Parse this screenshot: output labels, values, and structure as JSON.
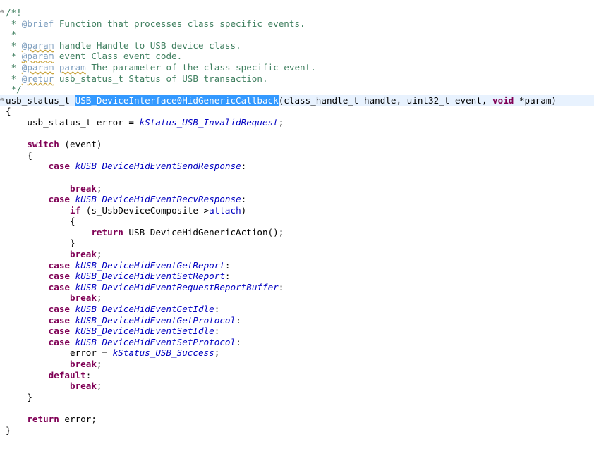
{
  "editor": {
    "lines": [
      {
        "fold": "⊖",
        "tokens": [
          {
            "t": "/*!",
            "c": "comment"
          }
        ]
      },
      {
        "fold": "",
        "tokens": [
          {
            "t": " * ",
            "c": "comment"
          },
          {
            "t": "@brief",
            "c": "doctag"
          },
          {
            "t": " Function that processes class specific events.",
            "c": "comment"
          }
        ]
      },
      {
        "fold": "",
        "tokens": [
          {
            "t": " *",
            "c": "comment"
          }
        ]
      },
      {
        "fold": "",
        "tokens": [
          {
            "t": " * ",
            "c": "comment"
          },
          {
            "t": "@param",
            "c": "doctag-misspelled"
          },
          {
            "t": " handle Handle to USB device class.",
            "c": "comment"
          }
        ]
      },
      {
        "fold": "",
        "tokens": [
          {
            "t": " * ",
            "c": "comment"
          },
          {
            "t": "@param",
            "c": "doctag-misspelled"
          },
          {
            "t": " event Class event code.",
            "c": "comment"
          }
        ]
      },
      {
        "fold": "",
        "tokens": [
          {
            "t": " * ",
            "c": "comment"
          },
          {
            "t": "@param",
            "c": "doctag-misspelled"
          },
          {
            "t": " ",
            "c": "comment"
          },
          {
            "t": "param",
            "c": "doctag-misspelled"
          },
          {
            "t": " The parameter of the class specific event.",
            "c": "comment"
          }
        ]
      },
      {
        "fold": "",
        "tokens": [
          {
            "t": " * ",
            "c": "comment"
          },
          {
            "t": "@retur",
            "c": "doctag-misspelled"
          },
          {
            "t": " usb_status_t Status of USB transaction.",
            "c": "comment"
          }
        ]
      },
      {
        "fold": "",
        "tokens": [
          {
            "t": " */",
            "c": "comment"
          }
        ]
      },
      {
        "fold": "⊖",
        "current": true,
        "tokens": [
          {
            "t": "usb_status_t ",
            "c": "plain"
          },
          {
            "t": "USB_DeviceInterface0HidGenericCallback",
            "c": "selected"
          },
          {
            "t": "(class_handle_t handle, uint32_t event, ",
            "c": "plain"
          },
          {
            "t": "void",
            "c": "keyword"
          },
          {
            "t": " *param)",
            "c": "plain"
          }
        ]
      },
      {
        "fold": "",
        "tokens": [
          {
            "t": "{",
            "c": "plain"
          }
        ]
      },
      {
        "fold": "",
        "tokens": [
          {
            "t": "    usb_status_t error = ",
            "c": "plain"
          },
          {
            "t": "kStatus_USB_InvalidRequest",
            "c": "enumconst"
          },
          {
            "t": ";",
            "c": "plain"
          }
        ]
      },
      {
        "fold": "",
        "tokens": [
          {
            "t": "",
            "c": "plain"
          }
        ]
      },
      {
        "fold": "",
        "tokens": [
          {
            "t": "    ",
            "c": "plain"
          },
          {
            "t": "switch",
            "c": "keyword"
          },
          {
            "t": " (event)",
            "c": "plain"
          }
        ]
      },
      {
        "fold": "",
        "tokens": [
          {
            "t": "    {",
            "c": "plain"
          }
        ]
      },
      {
        "fold": "",
        "tokens": [
          {
            "t": "        ",
            "c": "plain"
          },
          {
            "t": "case",
            "c": "keyword"
          },
          {
            "t": " ",
            "c": "plain"
          },
          {
            "t": "kUSB_DeviceHidEventSendResponse",
            "c": "enumconst"
          },
          {
            "t": ":",
            "c": "plain"
          }
        ]
      },
      {
        "fold": "",
        "tokens": [
          {
            "t": "",
            "c": "plain"
          }
        ]
      },
      {
        "fold": "",
        "tokens": [
          {
            "t": "            ",
            "c": "plain"
          },
          {
            "t": "break",
            "c": "keyword"
          },
          {
            "t": ";",
            "c": "plain"
          }
        ]
      },
      {
        "fold": "",
        "tokens": [
          {
            "t": "        ",
            "c": "plain"
          },
          {
            "t": "case",
            "c": "keyword"
          },
          {
            "t": " ",
            "c": "plain"
          },
          {
            "t": "kUSB_DeviceHidEventRecvResponse",
            "c": "enumconst"
          },
          {
            "t": ":",
            "c": "plain"
          }
        ]
      },
      {
        "fold": "",
        "tokens": [
          {
            "t": "            ",
            "c": "plain"
          },
          {
            "t": "if",
            "c": "keyword"
          },
          {
            "t": " (s_UsbDeviceComposite->",
            "c": "plain"
          },
          {
            "t": "attach",
            "c": "field"
          },
          {
            "t": ")",
            "c": "plain"
          }
        ]
      },
      {
        "fold": "",
        "tokens": [
          {
            "t": "            {",
            "c": "plain"
          }
        ]
      },
      {
        "fold": "",
        "tokens": [
          {
            "t": "                ",
            "c": "plain"
          },
          {
            "t": "return",
            "c": "keyword"
          },
          {
            "t": " USB_DeviceHidGenericAction();",
            "c": "plain"
          }
        ]
      },
      {
        "fold": "",
        "tokens": [
          {
            "t": "            }",
            "c": "plain"
          }
        ]
      },
      {
        "fold": "",
        "tokens": [
          {
            "t": "            ",
            "c": "plain"
          },
          {
            "t": "break",
            "c": "keyword"
          },
          {
            "t": ";",
            "c": "plain"
          }
        ]
      },
      {
        "fold": "",
        "tokens": [
          {
            "t": "        ",
            "c": "plain"
          },
          {
            "t": "case",
            "c": "keyword"
          },
          {
            "t": " ",
            "c": "plain"
          },
          {
            "t": "kUSB_DeviceHidEventGetReport",
            "c": "enumconst"
          },
          {
            "t": ":",
            "c": "plain"
          }
        ]
      },
      {
        "fold": "",
        "tokens": [
          {
            "t": "        ",
            "c": "plain"
          },
          {
            "t": "case",
            "c": "keyword"
          },
          {
            "t": " ",
            "c": "plain"
          },
          {
            "t": "kUSB_DeviceHidEventSetReport",
            "c": "enumconst"
          },
          {
            "t": ":",
            "c": "plain"
          }
        ]
      },
      {
        "fold": "",
        "tokens": [
          {
            "t": "        ",
            "c": "plain"
          },
          {
            "t": "case",
            "c": "keyword"
          },
          {
            "t": " ",
            "c": "plain"
          },
          {
            "t": "kUSB_DeviceHidEventRequestReportBuffer",
            "c": "enumconst"
          },
          {
            "t": ":",
            "c": "plain"
          }
        ]
      },
      {
        "fold": "",
        "tokens": [
          {
            "t": "            ",
            "c": "plain"
          },
          {
            "t": "break",
            "c": "keyword"
          },
          {
            "t": ";",
            "c": "plain"
          }
        ]
      },
      {
        "fold": "",
        "tokens": [
          {
            "t": "        ",
            "c": "plain"
          },
          {
            "t": "case",
            "c": "keyword"
          },
          {
            "t": " ",
            "c": "plain"
          },
          {
            "t": "kUSB_DeviceHidEventGetIdle",
            "c": "enumconst"
          },
          {
            "t": ":",
            "c": "plain"
          }
        ]
      },
      {
        "fold": "",
        "tokens": [
          {
            "t": "        ",
            "c": "plain"
          },
          {
            "t": "case",
            "c": "keyword"
          },
          {
            "t": " ",
            "c": "plain"
          },
          {
            "t": "kUSB_DeviceHidEventGetProtocol",
            "c": "enumconst"
          },
          {
            "t": ":",
            "c": "plain"
          }
        ]
      },
      {
        "fold": "",
        "tokens": [
          {
            "t": "        ",
            "c": "plain"
          },
          {
            "t": "case",
            "c": "keyword"
          },
          {
            "t": " ",
            "c": "plain"
          },
          {
            "t": "kUSB_DeviceHidEventSetIdle",
            "c": "enumconst"
          },
          {
            "t": ":",
            "c": "plain"
          }
        ]
      },
      {
        "fold": "",
        "tokens": [
          {
            "t": "        ",
            "c": "plain"
          },
          {
            "t": "case",
            "c": "keyword"
          },
          {
            "t": " ",
            "c": "plain"
          },
          {
            "t": "kUSB_DeviceHidEventSetProtocol",
            "c": "enumconst"
          },
          {
            "t": ":",
            "c": "plain"
          }
        ]
      },
      {
        "fold": "",
        "tokens": [
          {
            "t": "            error = ",
            "c": "plain"
          },
          {
            "t": "kStatus_USB_Success",
            "c": "enumconst"
          },
          {
            "t": ";",
            "c": "plain"
          }
        ]
      },
      {
        "fold": "",
        "tokens": [
          {
            "t": "            ",
            "c": "plain"
          },
          {
            "t": "break",
            "c": "keyword"
          },
          {
            "t": ";",
            "c": "plain"
          }
        ]
      },
      {
        "fold": "",
        "tokens": [
          {
            "t": "        ",
            "c": "plain"
          },
          {
            "t": "default",
            "c": "keyword"
          },
          {
            "t": ":",
            "c": "plain"
          }
        ]
      },
      {
        "fold": "",
        "tokens": [
          {
            "t": "            ",
            "c": "plain"
          },
          {
            "t": "break",
            "c": "keyword"
          },
          {
            "t": ";",
            "c": "plain"
          }
        ]
      },
      {
        "fold": "",
        "tokens": [
          {
            "t": "    }",
            "c": "plain"
          }
        ]
      },
      {
        "fold": "",
        "tokens": [
          {
            "t": "",
            "c": "plain"
          }
        ]
      },
      {
        "fold": "",
        "tokens": [
          {
            "t": "    ",
            "c": "plain"
          },
          {
            "t": "return",
            "c": "keyword"
          },
          {
            "t": " error;",
            "c": "plain"
          }
        ]
      },
      {
        "fold": "",
        "tokens": [
          {
            "t": "}",
            "c": "plain"
          }
        ]
      }
    ]
  },
  "colors": {
    "comment": "#3f7f5f",
    "doctag": "#7f9fbf",
    "keyword": "#7f0055",
    "enum_constant": "#0000c0",
    "selection": "#3399ff",
    "current_line": "#e8f2fe"
  },
  "icons": {
    "fold_marker": "collapse-fold-icon"
  }
}
